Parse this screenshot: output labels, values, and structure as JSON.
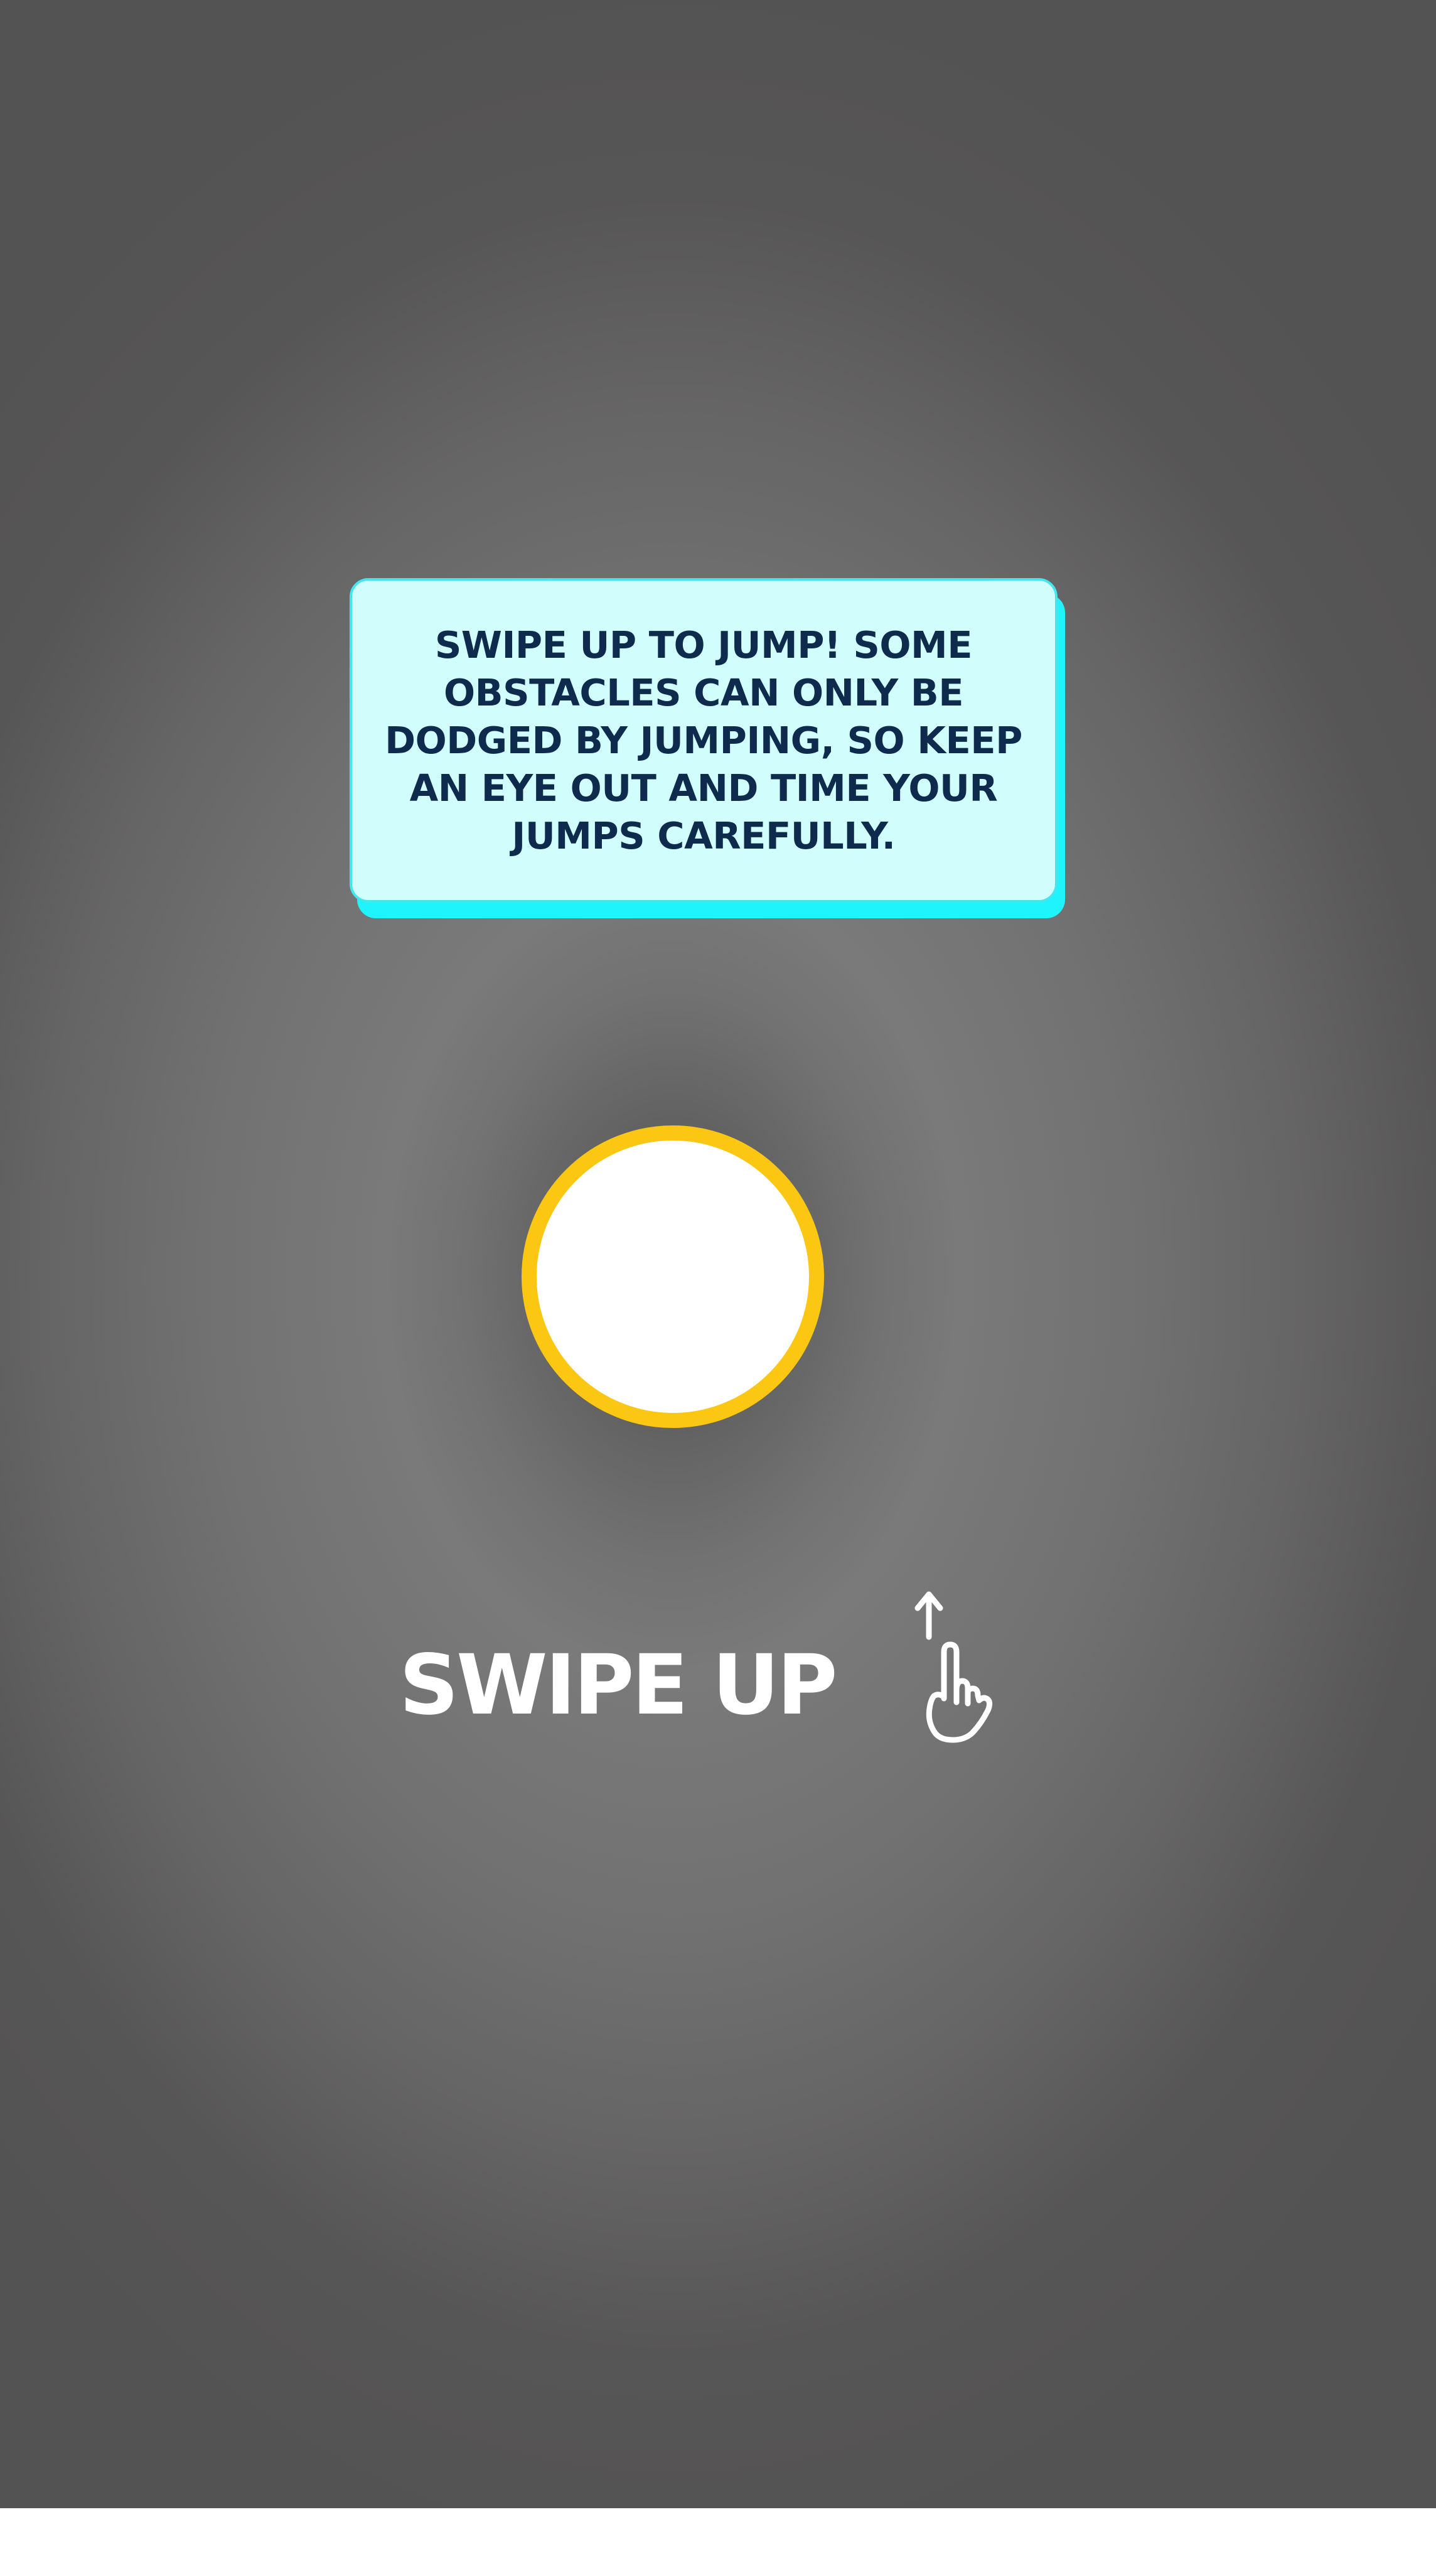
{
  "tutorial": {
    "message": "SWIPE UP TO JUMP! SOME OBSTACLES CAN ONLY BE DODGED BY JUMPING, SO KEEP AN EYE OUT AND TIME YOUR JUMPS CAREFULLY."
  },
  "gesture": {
    "label": "SWIPE UP",
    "icon": "swipe-up-hand-icon"
  },
  "colors": {
    "card_fill": "#d2fdfd",
    "card_shadow": "#1ff3fb",
    "card_text": "#0e2b4d",
    "target_ring": "#fbc712",
    "target_fill": "#ffffff"
  }
}
